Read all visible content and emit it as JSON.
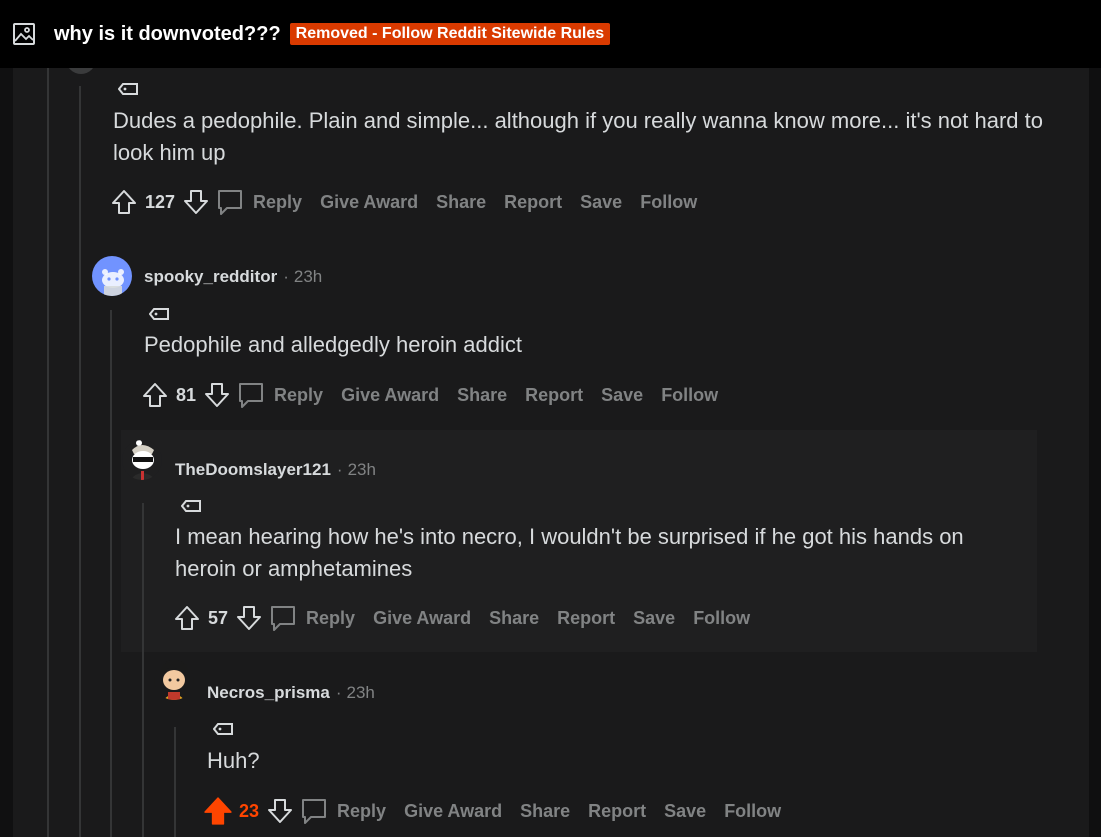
{
  "post": {
    "title": "why is it downvoted???",
    "removed_badge": "Removed - Follow Reddit Sitewide Rules"
  },
  "actions": {
    "reply": "Reply",
    "give_award": "Give Award",
    "share": "Share",
    "report": "Report",
    "save": "Save",
    "follow": "Follow"
  },
  "comments": [
    {
      "author": "",
      "time": "",
      "body": "Dudes a pedophile. Plain and simple... although if you really wanna know more... it's not hard to look him up",
      "score": "127",
      "upvoted": false
    },
    {
      "author": "spooky_redditor",
      "time": "23h",
      "body": "Pedophile and alledgedly heroin addict",
      "score": "81",
      "upvoted": false
    },
    {
      "author": "TheDoomslayer121",
      "time": "23h",
      "body": "I mean hearing how he's into necro, I wouldn't be surprised if he got his hands on heroin or amphetamines",
      "score": "57",
      "upvoted": false
    },
    {
      "author": "Necros_prisma",
      "time": "23h",
      "body": "Huh?",
      "score": "23",
      "upvoted": true
    }
  ],
  "colors": {
    "upvote_active": "#ff4500",
    "badge_removed": "#d93a00",
    "muted_text": "#818384"
  }
}
